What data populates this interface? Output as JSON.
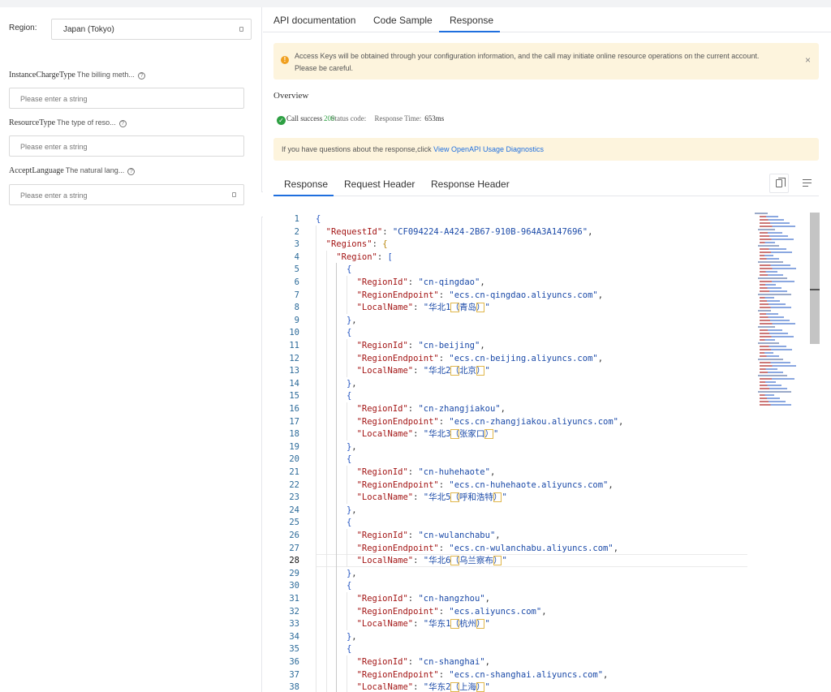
{
  "left": {
    "region_label": "Region:",
    "region_value": "Japan (Tokyo)",
    "params": [
      {
        "name": "InstanceChargeType",
        "desc": "The billing meth...",
        "placeholder": "Please enter a string"
      },
      {
        "name": "ResourceType",
        "desc": "The type of reso...",
        "placeholder": "Please enter a string"
      },
      {
        "name": "AcceptLanguage",
        "desc": "The natural lang...",
        "placeholder": "Please enter a string"
      }
    ],
    "help_glyph": "?",
    "collapse_glyph": "‹"
  },
  "tabs": [
    "API documentation",
    "Code Sample",
    "Response"
  ],
  "active_tab": "Response",
  "warning": {
    "text": "Access Keys will be obtained through your configuration information, and the call may initiate online resource operations on the current account. Please be careful.",
    "close": "×"
  },
  "overview": {
    "title": "Overview",
    "status_text": "Call success",
    "status_code_label": "Status code:",
    "status_code": "200",
    "response_time_label": "Response Time:",
    "response_time": "653ms"
  },
  "diagnostics": {
    "text": "If you have questions about the response,click ",
    "link": "View OpenAPI Usage Diagnostics"
  },
  "subtabs": [
    "Response",
    "Request Header",
    "Response Header"
  ],
  "active_subtab": "Response",
  "editor": {
    "current_line": 28,
    "lines": [
      {
        "n": "1",
        "html": "<span class='br1'>{</span>"
      },
      {
        "n": "2",
        "html": "  <span class='k'>\"RequestId\"</span>: <span class='s'>\"CF094224-A424-2B67-910B-964A3A147696\"</span>,"
      },
      {
        "n": "3",
        "html": "  <span class='k'>\"Regions\"</span>: <span class='br2'>{</span>"
      },
      {
        "n": "4",
        "html": "    <span class='k'>\"Region\"</span>: <span class='br3'>[</span>"
      },
      {
        "n": "5",
        "html": "      <span class='br1'>{</span>"
      },
      {
        "n": "6",
        "html": "        <span class='k'>\"RegionId\"</span>: <span class='s'>\"cn-qingdao\"</span>,"
      },
      {
        "n": "7",
        "html": "        <span class='k'>\"RegionEndpoint\"</span>: <span class='s'>\"ecs.cn-qingdao.aliyuncs.com\"</span>,"
      },
      {
        "n": "8",
        "html": "        <span class='k'>\"LocalName\"</span>: <span class='s'>\"华北1<span class='hl'>（</span>青岛<span class='hl'>）</span>\"</span>"
      },
      {
        "n": "9",
        "html": "      <span class='br1'>}</span>,"
      },
      {
        "n": "10",
        "html": "      <span class='br1'>{</span>"
      },
      {
        "n": "11",
        "html": "        <span class='k'>\"RegionId\"</span>: <span class='s'>\"cn-beijing\"</span>,"
      },
      {
        "n": "12",
        "html": "        <span class='k'>\"RegionEndpoint\"</span>: <span class='s'>\"ecs.cn-beijing.aliyuncs.com\"</span>,"
      },
      {
        "n": "13",
        "html": "        <span class='k'>\"LocalName\"</span>: <span class='s'>\"华北2<span class='hl'>（</span>北京<span class='hl'>）</span>\"</span>"
      },
      {
        "n": "14",
        "html": "      <span class='br1'>}</span>,"
      },
      {
        "n": "15",
        "html": "      <span class='br1'>{</span>"
      },
      {
        "n": "16",
        "html": "        <span class='k'>\"RegionId\"</span>: <span class='s'>\"cn-zhangjiakou\"</span>,"
      },
      {
        "n": "17",
        "html": "        <span class='k'>\"RegionEndpoint\"</span>: <span class='s'>\"ecs.cn-zhangjiakou.aliyuncs.com\"</span>,"
      },
      {
        "n": "18",
        "html": "        <span class='k'>\"LocalName\"</span>: <span class='s'>\"华北3<span class='hl'>（</span>张家口<span class='hl'>）</span>\"</span>"
      },
      {
        "n": "19",
        "html": "      <span class='br1'>}</span>,"
      },
      {
        "n": "20",
        "html": "      <span class='br1'>{</span>"
      },
      {
        "n": "21",
        "html": "        <span class='k'>\"RegionId\"</span>: <span class='s'>\"cn-huhehaote\"</span>,"
      },
      {
        "n": "22",
        "html": "        <span class='k'>\"RegionEndpoint\"</span>: <span class='s'>\"ecs.cn-huhehaote.aliyuncs.com\"</span>,"
      },
      {
        "n": "23",
        "html": "        <span class='k'>\"LocalName\"</span>: <span class='s'>\"华北5<span class='hl'>（</span>呼和浩特<span class='hl'>）</span>\"</span>"
      },
      {
        "n": "24",
        "html": "      <span class='br1'>}</span>,"
      },
      {
        "n": "25",
        "html": "      <span class='br1'>{</span>"
      },
      {
        "n": "26",
        "html": "        <span class='k'>\"RegionId\"</span>: <span class='s'>\"cn-wulanchabu\"</span>,"
      },
      {
        "n": "27",
        "html": "        <span class='k'>\"RegionEndpoint\"</span>: <span class='s'>\"ecs.cn-wulanchabu.aliyuncs.com\"</span>,"
      },
      {
        "n": "28",
        "html": "        <span class='k'>\"LocalName\"</span>: <span class='s'>\"华北6<span class='hl'>（</span>乌兰察布<span class='hl'>）</span>\"</span>"
      },
      {
        "n": "29",
        "html": "      <span class='br1'>}</span>,"
      },
      {
        "n": "30",
        "html": "      <span class='br1'>{</span>"
      },
      {
        "n": "31",
        "html": "        <span class='k'>\"RegionId\"</span>: <span class='s'>\"cn-hangzhou\"</span>,"
      },
      {
        "n": "32",
        "html": "        <span class='k'>\"RegionEndpoint\"</span>: <span class='s'>\"ecs.aliyuncs.com\"</span>,"
      },
      {
        "n": "33",
        "html": "        <span class='k'>\"LocalName\"</span>: <span class='s'>\"华东1<span class='hl'>（</span>杭州<span class='hl'>）</span>\"</span>"
      },
      {
        "n": "34",
        "html": "      <span class='br1'>}</span>,"
      },
      {
        "n": "35",
        "html": "      <span class='br1'>{</span>"
      },
      {
        "n": "36",
        "html": "        <span class='k'>\"RegionId\"</span>: <span class='s'>\"cn-shanghai\"</span>,"
      },
      {
        "n": "37",
        "html": "        <span class='k'>\"RegionEndpoint\"</span>: <span class='s'>\"ecs.cn-shanghai.aliyuncs.com\"</span>,"
      },
      {
        "n": "38",
        "html": "        <span class='k'>\"LocalName\"</span>: <span class='s'>\"华东2<span class='hl'>（</span>上海<span class='hl'>）</span>\"</span>"
      }
    ]
  },
  "colors": {
    "accent": "#1f6fde",
    "warning_bg": "#fdf4dd",
    "success": "#2ea043"
  },
  "icons": {
    "warning": "warning-icon",
    "close": "close-icon",
    "success": "check-circle-icon",
    "copy": "copy-icon",
    "format": "format-icon"
  }
}
